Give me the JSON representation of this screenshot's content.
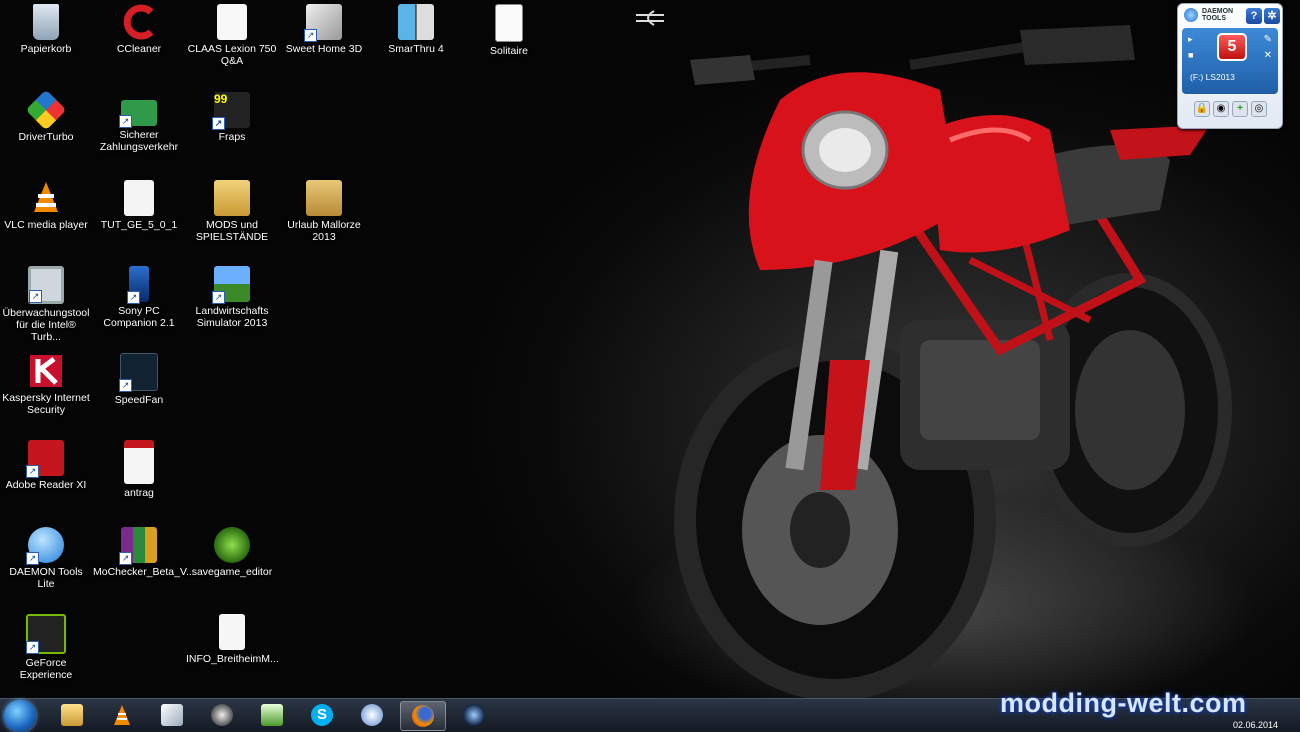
{
  "desktop_icons": [
    {
      "label": "Papierkorb"
    },
    {
      "label": "CCleaner"
    },
    {
      "label": "CLAAS Lexion 750 Q&A"
    },
    {
      "label": "Sweet Home 3D"
    },
    {
      "label": "SmarThru 4"
    },
    {
      "label": "Solitaire"
    },
    {
      "label": "DriverTurbo"
    },
    {
      "label": "Sicherer Zahlungsverkehr"
    },
    {
      "label": "Fraps"
    },
    {
      "label": "VLC media player"
    },
    {
      "label": "TUT_GE_5_0_1"
    },
    {
      "label": "MODS und SPIELSTÄNDE"
    },
    {
      "label": "Urlaub Mallorze 2013"
    },
    {
      "label": "Überwachungstool für die Intel® Turb..."
    },
    {
      "label": "Sony PC Companion 2.1"
    },
    {
      "label": "Landwirtschafts Simulator 2013"
    },
    {
      "label": "Kaspersky Internet Security"
    },
    {
      "label": "SpeedFan"
    },
    {
      "label": "Adobe Reader XI"
    },
    {
      "label": "antrag"
    },
    {
      "label": "DAEMON Tools Lite"
    },
    {
      "label": "MoChecker_Beta_V..."
    },
    {
      "label": "savegame_editor"
    },
    {
      "label": "GeForce Experience"
    },
    {
      "label": "INFO_BreitheimM..."
    }
  ],
  "daemon_widget": {
    "logo_line1": "DAEMON",
    "logo_line2": "TOOLS",
    "help": "?",
    "drive_label": "(F:) LS2013",
    "badge": "5"
  },
  "taskbar": {
    "apps": [
      "explorer-icon",
      "vlc-icon",
      "notepad-icon",
      "ccleaner-icon",
      "spreadsheet-icon",
      "skype-icon",
      "mail-icon",
      "firefox-icon",
      "camera-icon"
    ],
    "date": "02.06.2014"
  },
  "watermark": "modding-welt.com",
  "colors": {
    "bike_red": "#d8121a",
    "taskbar": "#1a2230"
  }
}
